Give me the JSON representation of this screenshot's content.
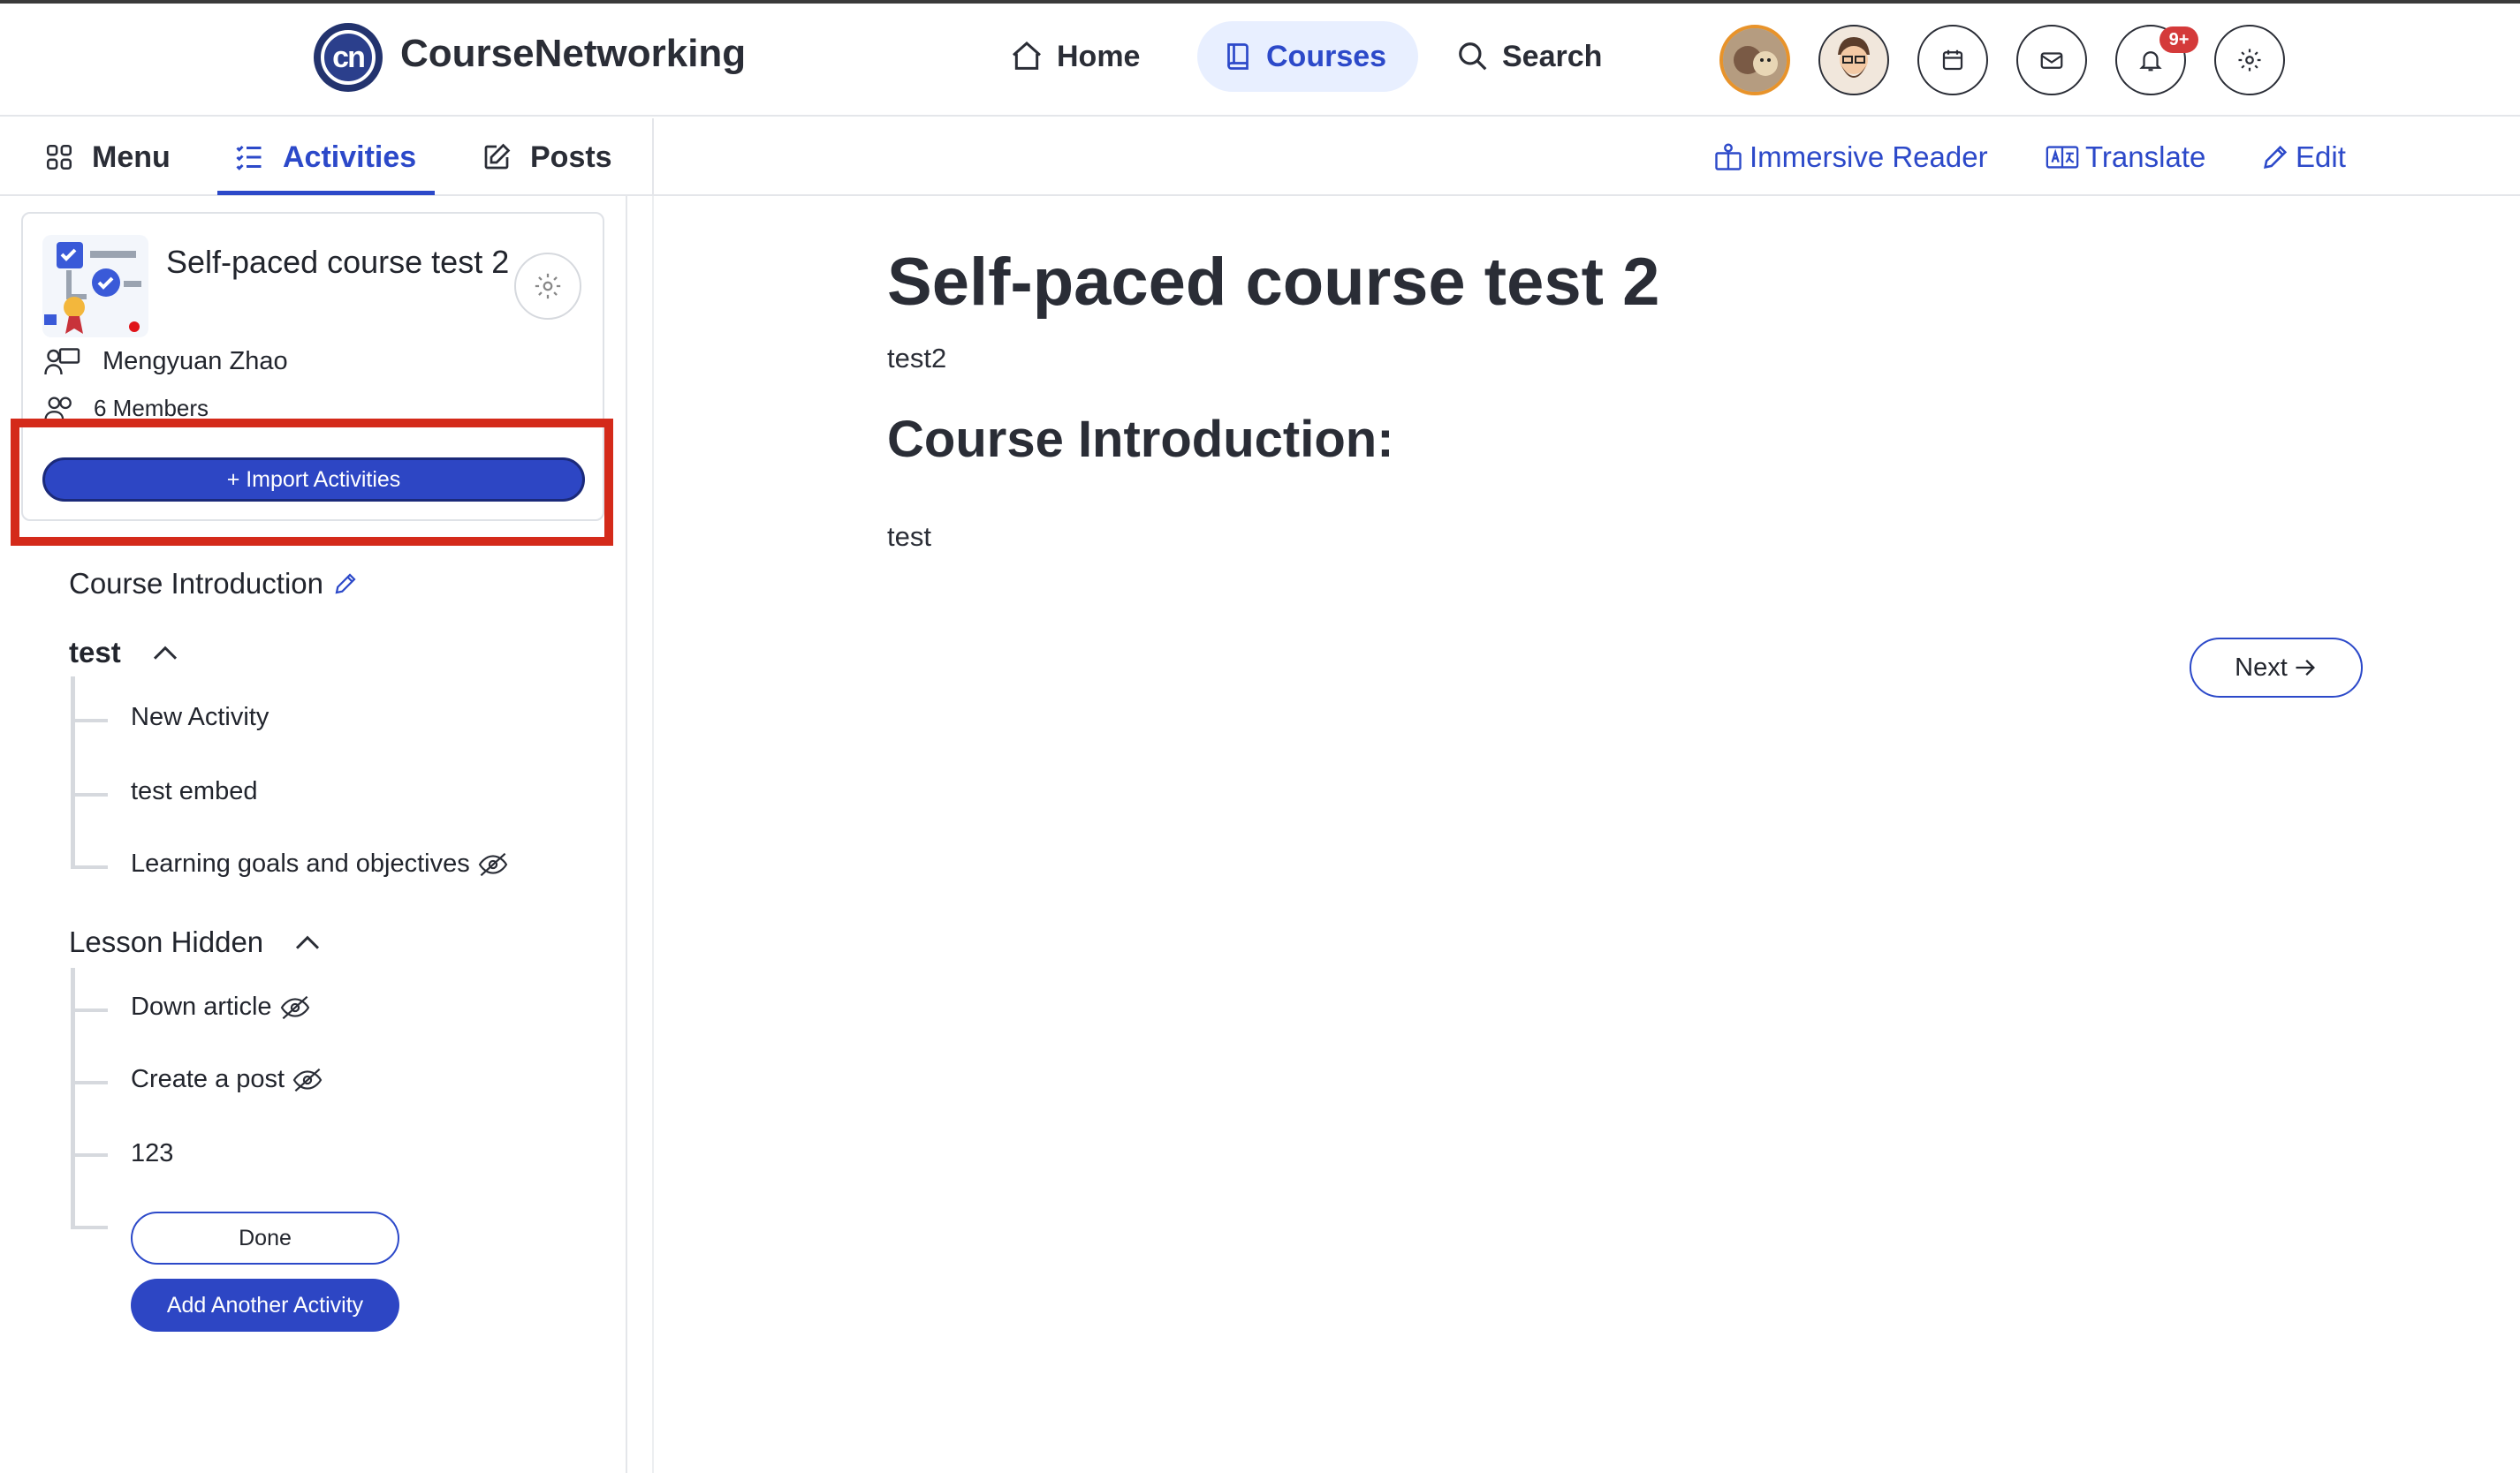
{
  "header": {
    "brand": "CourseNetworking",
    "logo_text": "cn",
    "nav": {
      "home": "Home",
      "courses": "Courses",
      "search": "Search"
    },
    "notification_badge": "9+"
  },
  "subnav": {
    "tabs": {
      "menu": "Menu",
      "activities": "Activities",
      "posts": "Posts"
    },
    "tools": {
      "immersive_reader": "Immersive Reader",
      "translate": "Translate",
      "edit": "Edit"
    }
  },
  "course_card": {
    "title": "Self-paced course test 2",
    "instructor": "Mengyuan Zhao",
    "members": "6 Members",
    "import_button": "+ Import Activities"
  },
  "outline": {
    "intro_title": "Course Introduction",
    "sections": [
      {
        "title": "test",
        "items": [
          "New Activity",
          "test embed",
          "Learning goals and objectives"
        ]
      },
      {
        "title": "Lesson Hidden",
        "items": [
          "Down article",
          "Create a post",
          "123"
        ]
      }
    ],
    "done_button": "Done",
    "add_button": "Add Another Activity"
  },
  "main": {
    "title": "Self-paced course test 2",
    "subtitle": "test2",
    "heading": "Course Introduction:",
    "body": "test",
    "next_button": "Next"
  },
  "colors": {
    "accent": "#2c49c9",
    "highlight": "#d42a1a",
    "badge": "#d43a3a"
  }
}
